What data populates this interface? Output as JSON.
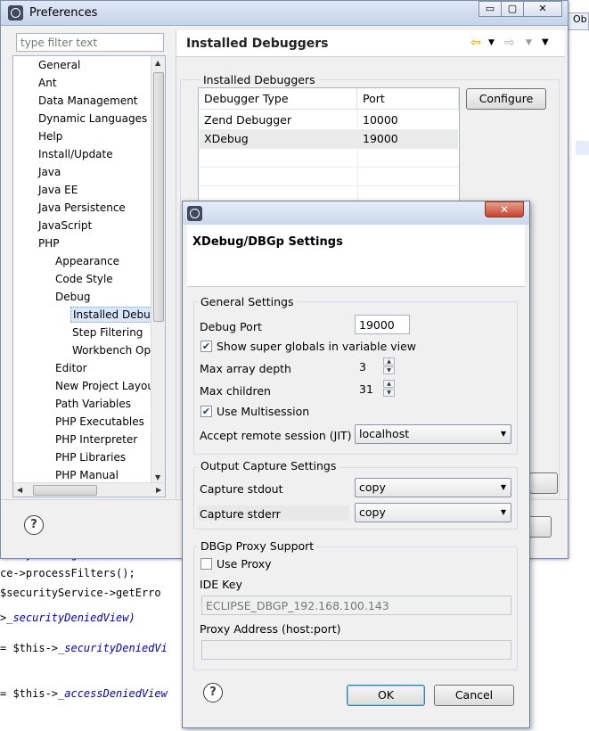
{
  "background": {
    "right_tab": "Ob",
    "code_lines": [
      {
        "text": "    BizSystem::getService",
        "kw": ""
      },
      {
        "text": "ce->processFilters();",
        "kw": ""
      },
      {
        "text": " $securityService->getErro",
        "kw": ""
      },
      {
        "text": ">",
        "kw": "_securityDeniedView)"
      },
      {
        "text": "= $this->",
        "kw": "_securityDeniedVi"
      },
      {
        "text": "= $this->",
        "kw": "_accessDeniedView"
      }
    ]
  },
  "preferences": {
    "title": "Preferences",
    "window_buttons": {
      "minimize": "▭",
      "maximize": "▢",
      "close": "✕"
    },
    "filter_placeholder": "type filter text",
    "tree": [
      {
        "label": "General",
        "level": 0
      },
      {
        "label": "Ant",
        "level": 0
      },
      {
        "label": "Data Management",
        "level": 0
      },
      {
        "label": "Dynamic Languages",
        "level": 0
      },
      {
        "label": "Help",
        "level": 0
      },
      {
        "label": "Install/Update",
        "level": 0
      },
      {
        "label": "Java",
        "level": 0
      },
      {
        "label": "Java EE",
        "level": 0
      },
      {
        "label": "Java Persistence",
        "level": 0
      },
      {
        "label": "JavaScript",
        "level": 0
      },
      {
        "label": "PHP",
        "level": 0
      },
      {
        "label": "Appearance",
        "level": 1
      },
      {
        "label": "Code Style",
        "level": 1
      },
      {
        "label": "Debug",
        "level": 1
      },
      {
        "label": "Installed Debugg",
        "level": 2,
        "selected": true
      },
      {
        "label": "Step Filtering",
        "level": 2
      },
      {
        "label": "Workbench Op",
        "level": 2
      },
      {
        "label": "Editor",
        "level": 1
      },
      {
        "label": "New Project Layou",
        "level": 1
      },
      {
        "label": "Path Variables",
        "level": 1
      },
      {
        "label": "PHP Executables",
        "level": 1
      },
      {
        "label": "PHP Interpreter",
        "level": 1
      },
      {
        "label": "PHP Libraries",
        "level": 1
      },
      {
        "label": "PHP Manual",
        "level": 1
      }
    ],
    "page_title": "Installed Debuggers",
    "nav": {
      "back": "⇦",
      "forward": "⇨",
      "menu": "▼"
    },
    "group_title": "Installed Debuggers",
    "table": {
      "columns": [
        "Debugger Type",
        "Port"
      ],
      "rows": [
        [
          "Zend Debugger",
          "10000"
        ],
        [
          "XDebug",
          "19000"
        ]
      ]
    },
    "configure_label": "Configure",
    "help": "?"
  },
  "xdebug_dialog": {
    "close": "✕",
    "title": "XDebug/DBGp Settings",
    "general": {
      "title": "General Settings",
      "debug_port_label": "Debug Port",
      "debug_port_value": "19000",
      "show_superglobals_label": "Show super globals in variable view",
      "show_superglobals_checked": true,
      "max_array_depth_label": "Max array depth",
      "max_array_depth_value": "3",
      "max_children_label": "Max children",
      "max_children_value": "31",
      "multisession_label": "Use Multisession",
      "multisession_checked": true,
      "remote_session_label": "Accept remote session (JIT)",
      "remote_session_value": "localhost"
    },
    "output": {
      "title": "Output Capture Settings",
      "stdout_label": "Capture stdout",
      "stdout_value": "copy",
      "stderr_label": "Capture stderr",
      "stderr_value": "copy"
    },
    "proxy": {
      "title": "DBGp Proxy Support",
      "use_proxy_label": "Use Proxy",
      "use_proxy_checked": false,
      "ide_key_label": "IDE Key",
      "ide_key_value": "ECLIPSE_DBGP_192.168.100.143",
      "proxy_address_label": "Proxy Address (host:port)",
      "proxy_address_value": ""
    },
    "ok_label": "OK",
    "cancel_label": "Cancel",
    "help": "?"
  }
}
